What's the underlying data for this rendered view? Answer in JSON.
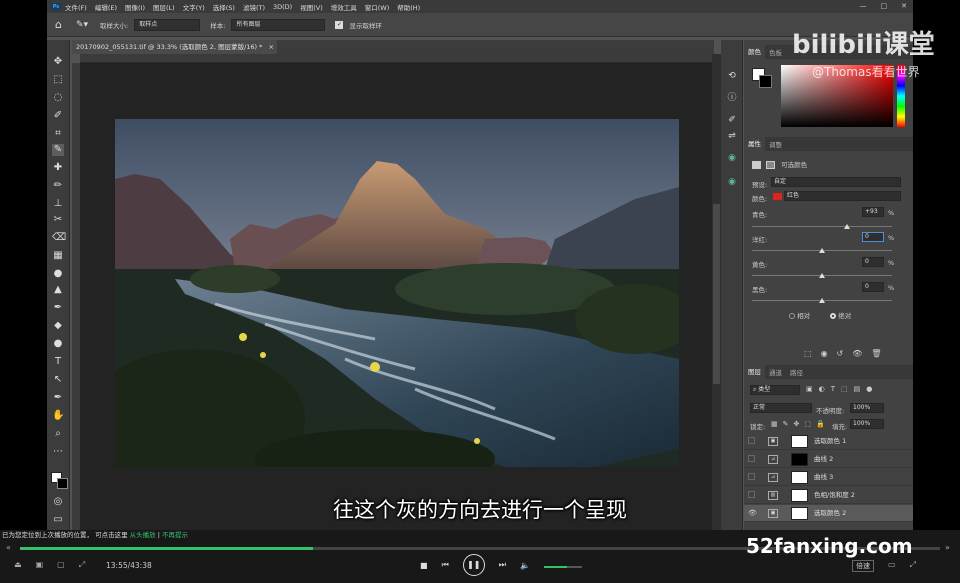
{
  "menubar": {
    "items": [
      "文件(F)",
      "编辑(E)",
      "图像(I)",
      "图层(L)",
      "文字(Y)",
      "选择(S)",
      "滤镜(T)",
      "3D(D)",
      "视图(V)",
      "增效工具",
      "窗口(W)",
      "帮助(H)"
    ],
    "window_controls": [
      "—",
      "□",
      "✕"
    ]
  },
  "options": {
    "sample_size_label": "取样大小:",
    "sample_size_value": "取样点",
    "sample_label": "样本:",
    "sample_value": "所有图层",
    "show_ring_label": "显示取样环"
  },
  "document": {
    "tab_title": "20170902_055131.tif @ 33.3% (选取颜色 2, 图层蒙版/16) *",
    "tab_close": "×"
  },
  "color_panel": {
    "tabs": [
      "颜色",
      "色板"
    ],
    "foreground": "#ffffff",
    "background": "#000000",
    "hue": "#ff0000"
  },
  "properties": {
    "tabs": [
      "属性",
      "调整"
    ],
    "adj_title": "可选颜色",
    "preset_label": "预设:",
    "preset_value": "自定",
    "colors_label": "颜色:",
    "colors_value": "红色",
    "swatch": "#e0241b",
    "sliders": [
      {
        "label": "青色:",
        "value": "+93",
        "unit": "%",
        "fraction": 0.68
      },
      {
        "label": "洋红:",
        "value": "0",
        "unit": "%",
        "fraction": 0.5
      },
      {
        "label": "黄色:",
        "value": "0",
        "unit": "%",
        "fraction": 0.5
      },
      {
        "label": "黑色:",
        "value": "0",
        "unit": "%",
        "fraction": 0.5
      }
    ],
    "method_relative": "相对",
    "method_absolute": "绝对"
  },
  "layers": {
    "tabs": [
      "图层",
      "通道",
      "路径"
    ],
    "kind_label": "类型",
    "blend_mode": "正常",
    "opacity_label": "不透明度:",
    "opacity_value": "100%",
    "lock_label": "锁定:",
    "fill_label": "填充:",
    "fill_value": "100%",
    "items": [
      {
        "name": "选取颜色 1",
        "icon": "▣",
        "visible": false,
        "selected": false,
        "mask": "white"
      },
      {
        "name": "曲线 2",
        "icon": "⊿",
        "visible": false,
        "selected": false,
        "mask": "black"
      },
      {
        "name": "曲线 3",
        "icon": "⊿",
        "visible": false,
        "selected": false,
        "mask": "white"
      },
      {
        "name": "色相/饱和度 2",
        "icon": "▥",
        "visible": false,
        "selected": false,
        "mask": "white"
      },
      {
        "name": "选取颜色 2",
        "icon": "▣",
        "visible": true,
        "selected": true,
        "mask": "white"
      }
    ]
  },
  "player": {
    "time": "13:55/43:38",
    "progress": 0.319,
    "volume": 0.6,
    "notice": "已为您定位到上次播放的位置，",
    "notice_link1": "可点击这里",
    "notice_link2": "从头播放",
    "notice_sep": "|",
    "notice_link3": "不再提示",
    "speed": "倍速"
  },
  "subtitle": "往这个灰的方向去进行一个呈现",
  "watermark": {
    "brand": "bilibili课堂",
    "user": "@Thomas看看世界",
    "site": "52fanxing.com"
  }
}
